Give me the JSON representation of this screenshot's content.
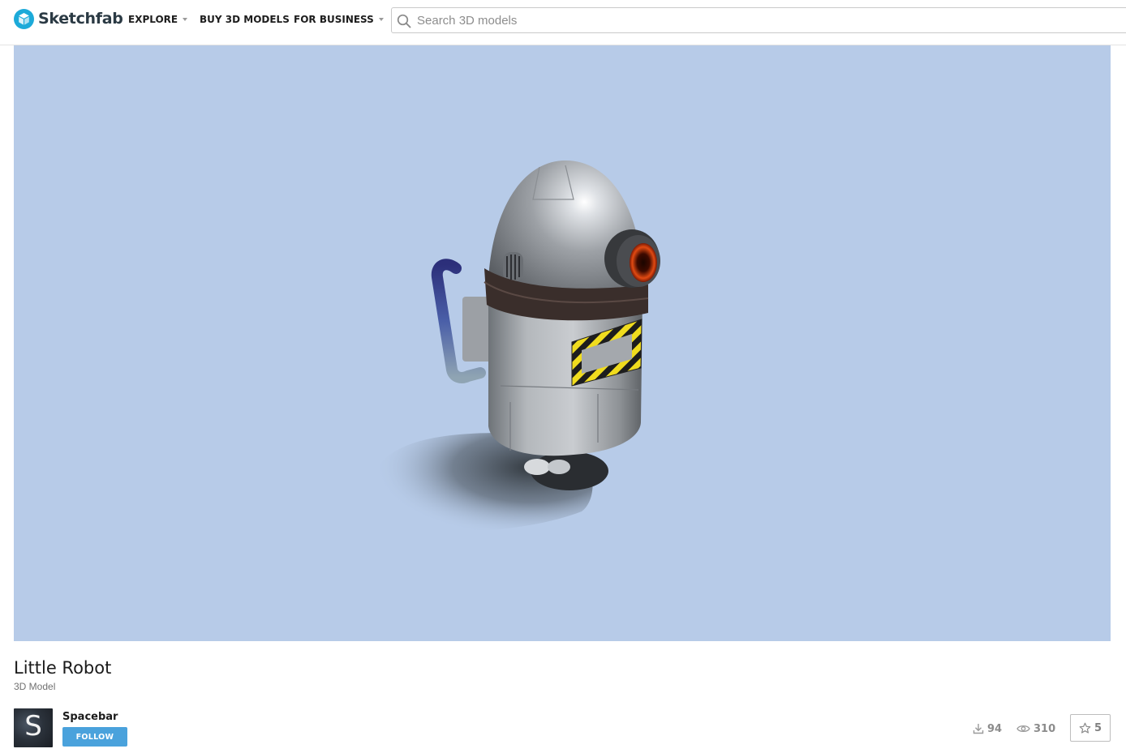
{
  "app": {
    "brand": "Sketchfab",
    "brand_color": "#1caad9",
    "logo_icon": "sketchfab-cube-icon"
  },
  "nav": {
    "explore": "EXPLORE",
    "buy": "BUY 3D MODELS",
    "business": "FOR BUSINESS"
  },
  "search": {
    "placeholder": "Search 3D models",
    "value": "",
    "icon": "search-icon"
  },
  "viewer": {
    "background": "#b7cbe8",
    "model": "robot"
  },
  "model": {
    "title": "Little Robot",
    "type": "3D Model"
  },
  "author": {
    "name": "Spacebar",
    "avatar_letter": "S",
    "follow_label": "FOLLOW",
    "follow_color": "#4aa2dc"
  },
  "stats": {
    "downloads": "94",
    "views": "310",
    "likes": "5",
    "download_icon": "download-icon",
    "view_icon": "eye-icon",
    "like_icon": "star-icon"
  }
}
